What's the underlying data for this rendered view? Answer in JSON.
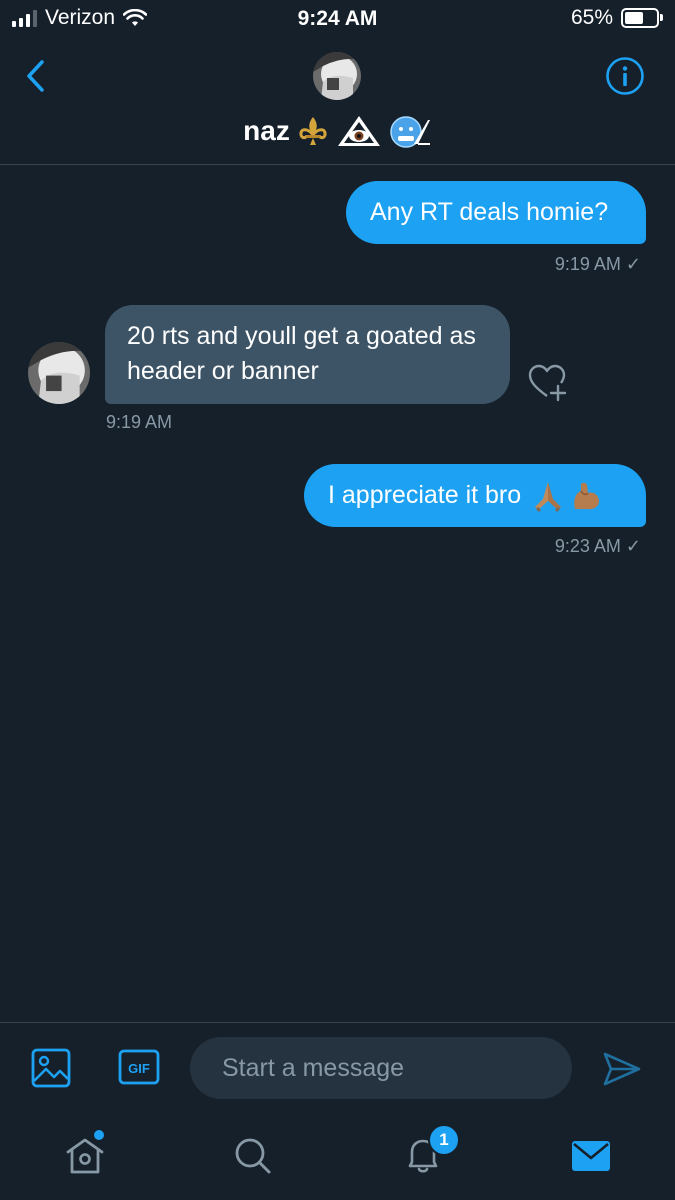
{
  "status_bar": {
    "carrier": "Verizon",
    "time": "9:24 AM",
    "battery": "65%",
    "battery_level": 0.65
  },
  "header": {
    "name": "naz",
    "name_emojis": [
      "fleur-de-lis",
      "eye-in-triangle",
      "cold-face"
    ],
    "back_icon": "chevron-left-icon",
    "info_icon": "info-icon"
  },
  "messages": [
    {
      "direction": "sent",
      "text": "Any RT deals homie?",
      "time": "9:19 AM",
      "check": "✓"
    },
    {
      "direction": "received",
      "text": "20 rts and youll get a goated as header or banner",
      "time": "9:19 AM"
    },
    {
      "direction": "sent",
      "text": "I appreciate it bro",
      "emojis": [
        "folded-hands",
        "flexed-biceps"
      ],
      "time": "9:23 AM",
      "check": "✓"
    }
  ],
  "composer": {
    "placeholder": "Start a message",
    "gif_label": "GIF"
  },
  "tabbar": {
    "items": [
      "home",
      "search",
      "notifications",
      "messages"
    ],
    "notifications_badge": "1"
  },
  "colors": {
    "background": "#15202b",
    "accent": "#1da1f2",
    "received_bubble": "#3d5466",
    "muted_text": "#8899a6",
    "divider": "#38444d"
  }
}
